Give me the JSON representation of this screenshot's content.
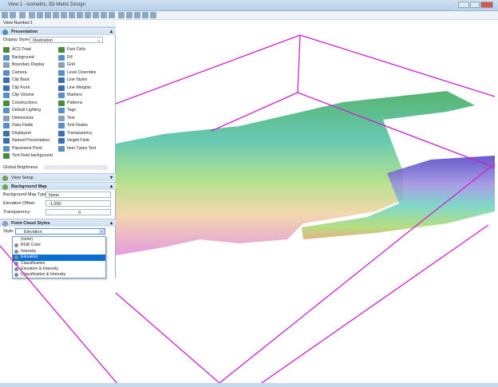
{
  "window": {
    "title": "View 1 - Isometric, 3D Metric Design",
    "min": "—",
    "max": "□",
    "close": "✕"
  },
  "view_number": {
    "label": "View Number:",
    "value": "1"
  },
  "presentation": {
    "title": "Presentation",
    "display_style_label": "Display Style:",
    "display_style_value": "Illustration",
    "left_items": [
      "ACS Triad",
      "Background",
      "Boundary Display",
      "Camera",
      "Clip Back",
      "Clip Front",
      "Clip Volume",
      "Constructions",
      "Default Lighting",
      "Dimensions",
      "Data Fields",
      "Displayset",
      "Named Presentation",
      "Placement Point",
      "Text Field background"
    ],
    "right_items": [
      "Fast Cells",
      "Fill",
      "Grid",
      "Level Overrides",
      "Line Styles",
      "Line Weights",
      "Markers",
      "Patterns",
      "Tags",
      "Text",
      "Text Nodes",
      "Transparency",
      "Height Field",
      "Item Types Text"
    ],
    "global_brightness_label": "Global Brightness"
  },
  "view_setup": {
    "title": "View Setup"
  },
  "background_map": {
    "title": "Background Map",
    "type_label": "Background Map Type:",
    "type_value": "None",
    "elev_label": "Elevation Offset:",
    "elev_value": "-1.000",
    "transp_label": "Transparency:",
    "transp_value": "0"
  },
  "point_cloud": {
    "title": "Point Cloud Styles",
    "style_label": "Style:",
    "style_value": "Elevation",
    "options": [
      "(none)",
      "RGB Color",
      "Intensity",
      "Elevation",
      "Classification",
      "Elevation & Intensity",
      "Classification & Intensity"
    ],
    "selected": "Elevation"
  },
  "colors": {
    "accent": "#0a6fd0",
    "range_box": "#cc22cc",
    "panel_header": "#cddff1"
  }
}
